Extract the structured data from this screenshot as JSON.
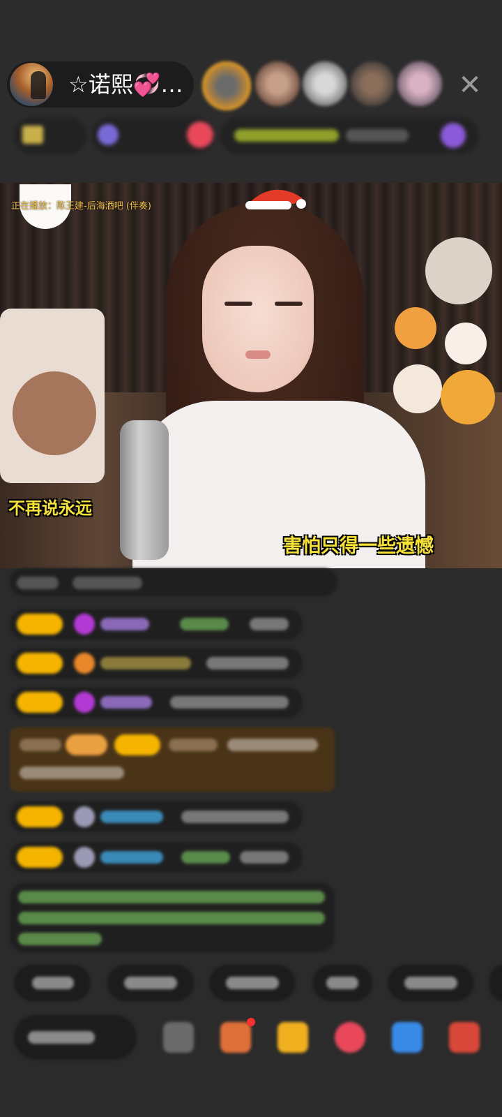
{
  "header": {
    "host_name": "☆诺熙💞…",
    "close_glyph": "✕"
  },
  "video": {
    "now_playing": "正在播放：陈王建-后海酒吧 (伴奏)",
    "lyric_left": "不再说永远",
    "lyric_right": "害怕只得一些遗憾"
  },
  "colors": {
    "background": "#2b2b2b",
    "lyric": "#f7e23a",
    "badge": "#f4b400",
    "gift_msg_bg": "#4a3418"
  },
  "icons": [
    "close-icon",
    "hat-icon",
    "emoji-icon",
    "gift-box-icon",
    "gift-icon",
    "heart-icon",
    "game-icon",
    "more-icon"
  ]
}
